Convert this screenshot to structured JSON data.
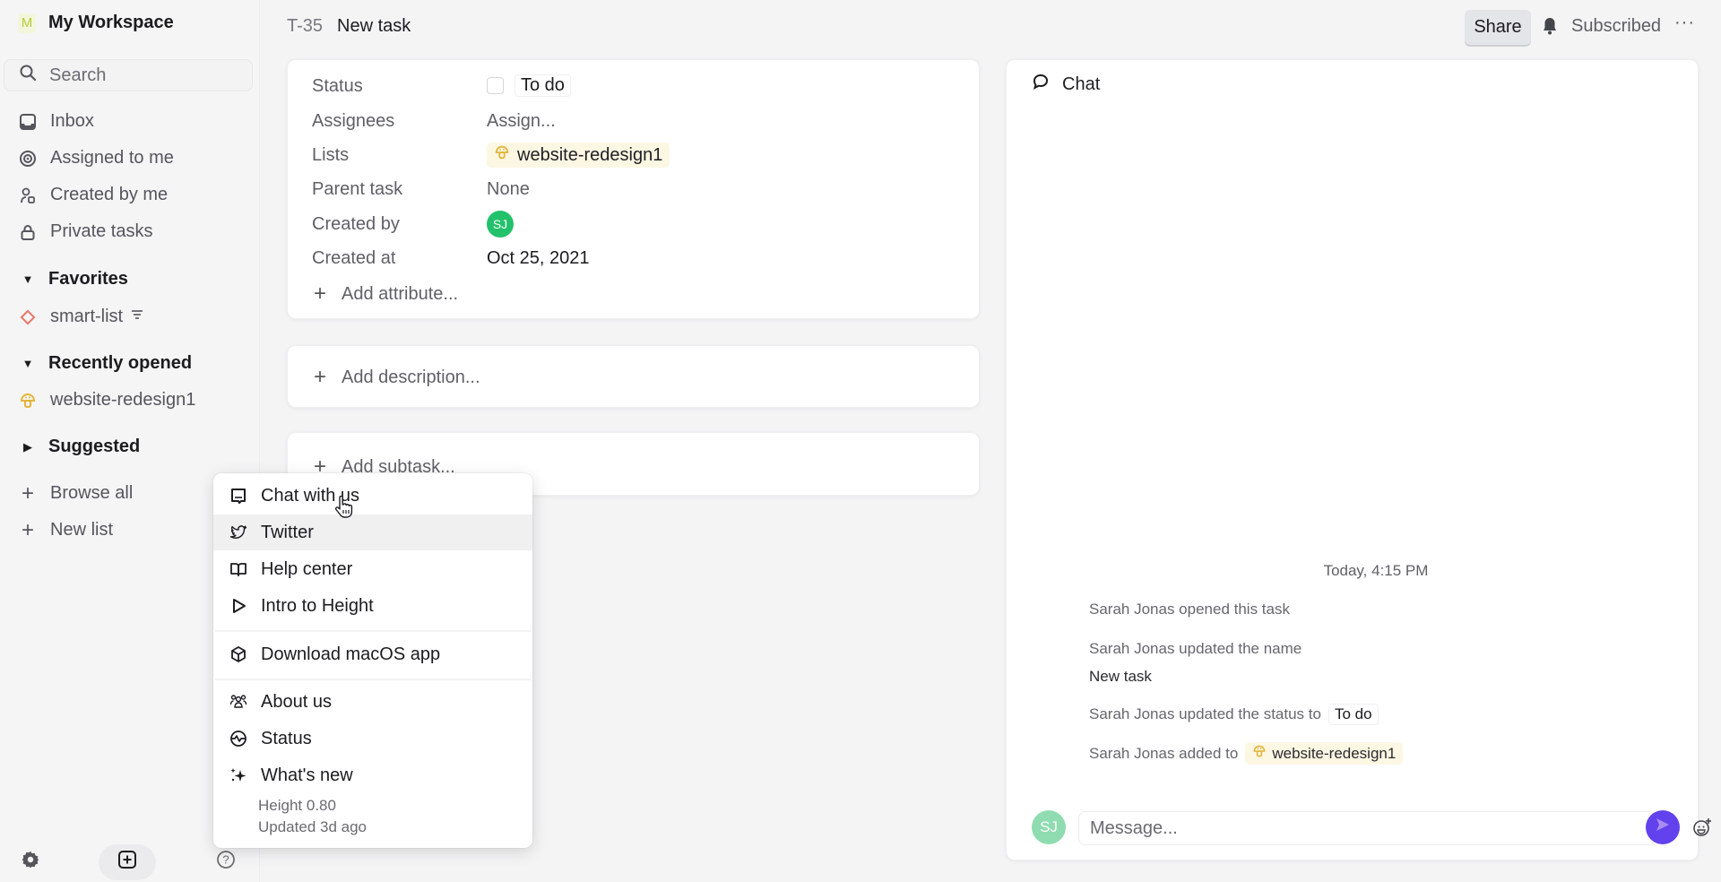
{
  "sidebar": {
    "workspace_badge": "M",
    "workspace_name": "My Workspace",
    "search_placeholder": "Search",
    "nav": [
      {
        "label": "Inbox",
        "icon": "inbox-icon"
      },
      {
        "label": "Assigned to me",
        "icon": "target-icon"
      },
      {
        "label": "Created by me",
        "icon": "user-icon"
      },
      {
        "label": "Private tasks",
        "icon": "lock-icon"
      }
    ],
    "sections": {
      "favorites": {
        "label": "Favorites",
        "expanded": true,
        "items": [
          {
            "label": "smart-list",
            "icon": "diamond-icon",
            "suffix_icon": "filter-icon"
          }
        ]
      },
      "recently_opened": {
        "label": "Recently opened",
        "expanded": true,
        "items": [
          {
            "label": "website-redesign1",
            "icon": "mushroom-icon"
          }
        ]
      },
      "suggested": {
        "label": "Suggested",
        "expanded": false
      }
    },
    "actions": [
      {
        "label": "Browse all"
      },
      {
        "label": "New list"
      }
    ]
  },
  "header": {
    "task_id": "T-35",
    "task_title": "New task",
    "share_label": "Share",
    "subscribed_label": "Subscribed",
    "more_label": "···"
  },
  "properties": {
    "rows": [
      {
        "label": "Status",
        "value": "To do"
      },
      {
        "label": "Assignees",
        "value": "Assign..."
      },
      {
        "label": "Lists",
        "value": "website-redesign1"
      },
      {
        "label": "Parent task",
        "value": "None"
      },
      {
        "label": "Created by",
        "value": "SJ"
      },
      {
        "label": "Created at",
        "value": "Oct 25, 2021"
      }
    ],
    "add_attribute": "Add attribute..."
  },
  "description": {
    "placeholder": "Add description..."
  },
  "subtasks": {
    "placeholder": "Add subtask..."
  },
  "chat": {
    "title": "Chat",
    "timestamp": "Today, 4:15 PM",
    "activity": [
      {
        "text": "Sarah Jonas opened this task"
      },
      {
        "text": "Sarah Jonas updated the name"
      },
      {
        "text": "New task"
      },
      {
        "text": "Sarah Jonas updated the status to",
        "pill": "To do"
      },
      {
        "text": "Sarah Jonas added to",
        "chip": "website-redesign1"
      }
    ],
    "composer": {
      "avatar": "SJ",
      "placeholder": "Message..."
    },
    "colors": {
      "send": "#6142ed",
      "avatar": "#8fdcb0"
    }
  },
  "help_menu": {
    "items": [
      {
        "label": "Chat with us",
        "icon": "chat-bubble-icon"
      },
      {
        "label": "Twitter",
        "icon": "twitter-icon",
        "hovered": true
      },
      {
        "label": "Help center",
        "icon": "book-icon"
      },
      {
        "label": "Intro to Height",
        "icon": "play-icon"
      },
      {
        "label": "Download macOS app",
        "icon": "box-icon"
      },
      {
        "label": "About us",
        "icon": "team-icon"
      },
      {
        "label": "Status",
        "icon": "pulse-icon"
      },
      {
        "label": "What's new",
        "icon": "sparkle-icon"
      }
    ],
    "version": "Height 0.80",
    "updated": "Updated 3d ago"
  },
  "colors": {
    "accent": "#6142ed",
    "creator_avatar": "#23c16b",
    "list_chip_bg": "#fcf7e3",
    "list_icon": "#e3b43a",
    "smart_list_icon": "#e8776a"
  }
}
